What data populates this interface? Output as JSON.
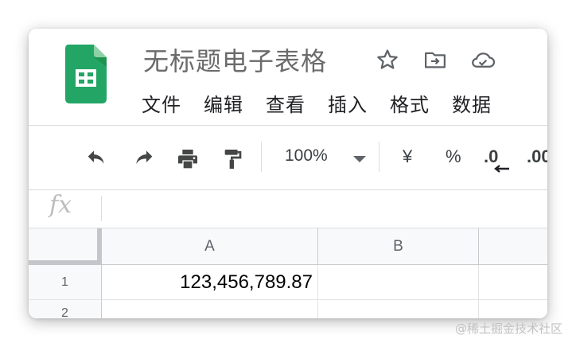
{
  "app": {
    "name": "Google Sheets",
    "document_title": "无标题电子表格"
  },
  "header_icons": [
    "star-icon",
    "move-to-folder-icon",
    "cloud-saved-icon"
  ],
  "menu": {
    "items": [
      "文件",
      "编辑",
      "查看",
      "插入",
      "格式",
      "数据"
    ]
  },
  "toolbar": {
    "zoom": "100%",
    "currency_label": "¥",
    "percent_label": "%",
    "decrease_decimal_label": ".0",
    "increase_decimal_label": ".00"
  },
  "formula_bar": {
    "fx_label": "fx",
    "value": ""
  },
  "sheet": {
    "columns": [
      "A",
      "B"
    ],
    "rows": [
      "1",
      "2"
    ],
    "cells": {
      "A1": "123,456,789.87"
    }
  },
  "watermark": "@稀土掘金技术社区",
  "colors": {
    "sheets_green": "#23a566",
    "sheets_green_dark": "#188038",
    "grid_header_bg": "#f8f9fa",
    "selection_gray": "#c4c6c9"
  }
}
